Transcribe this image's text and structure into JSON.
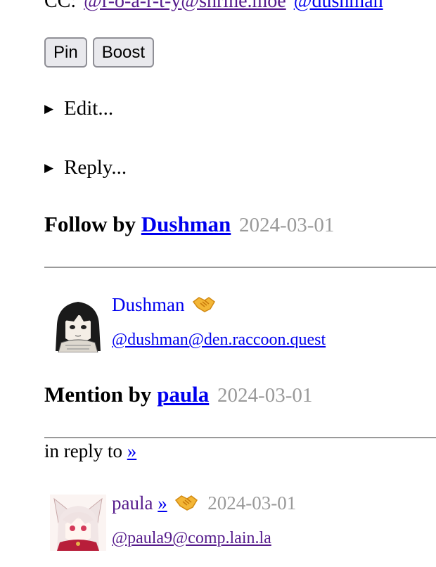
{
  "cc": {
    "label": "CC:",
    "recipients": [
      "@r-o-a-r-t-y@shrine.moe",
      "@dushman"
    ]
  },
  "actions": {
    "pin_label": "Pin",
    "boost_label": "Boost"
  },
  "details": {
    "edit_label": "Edit...",
    "reply_label": "Reply..."
  },
  "notifications": [
    {
      "kind": "Follow by",
      "actor": "Dushman",
      "date": "2024-03-01",
      "account": {
        "display_name": "Dushman",
        "handle": "@dushman@den.raccoon.quest"
      }
    },
    {
      "kind": "Mention by",
      "actor": "paula",
      "date": "2024-03-01",
      "in_reply_to_label": "in reply to",
      "in_reply_to_link": "»",
      "account": {
        "display_name": "paula",
        "link": "»",
        "date": "2024-03-01",
        "handle": "@paula9@comp.lain.la"
      }
    }
  ],
  "icons": {
    "follow_badge": "handshake-icon",
    "disclosure": "triangle-right-icon"
  },
  "colors": {
    "link": "#0000ee",
    "visited_link": "#551a8b",
    "date": "#999999",
    "rule": "#9a9a9a",
    "button_bg": "#e9e9ed"
  }
}
